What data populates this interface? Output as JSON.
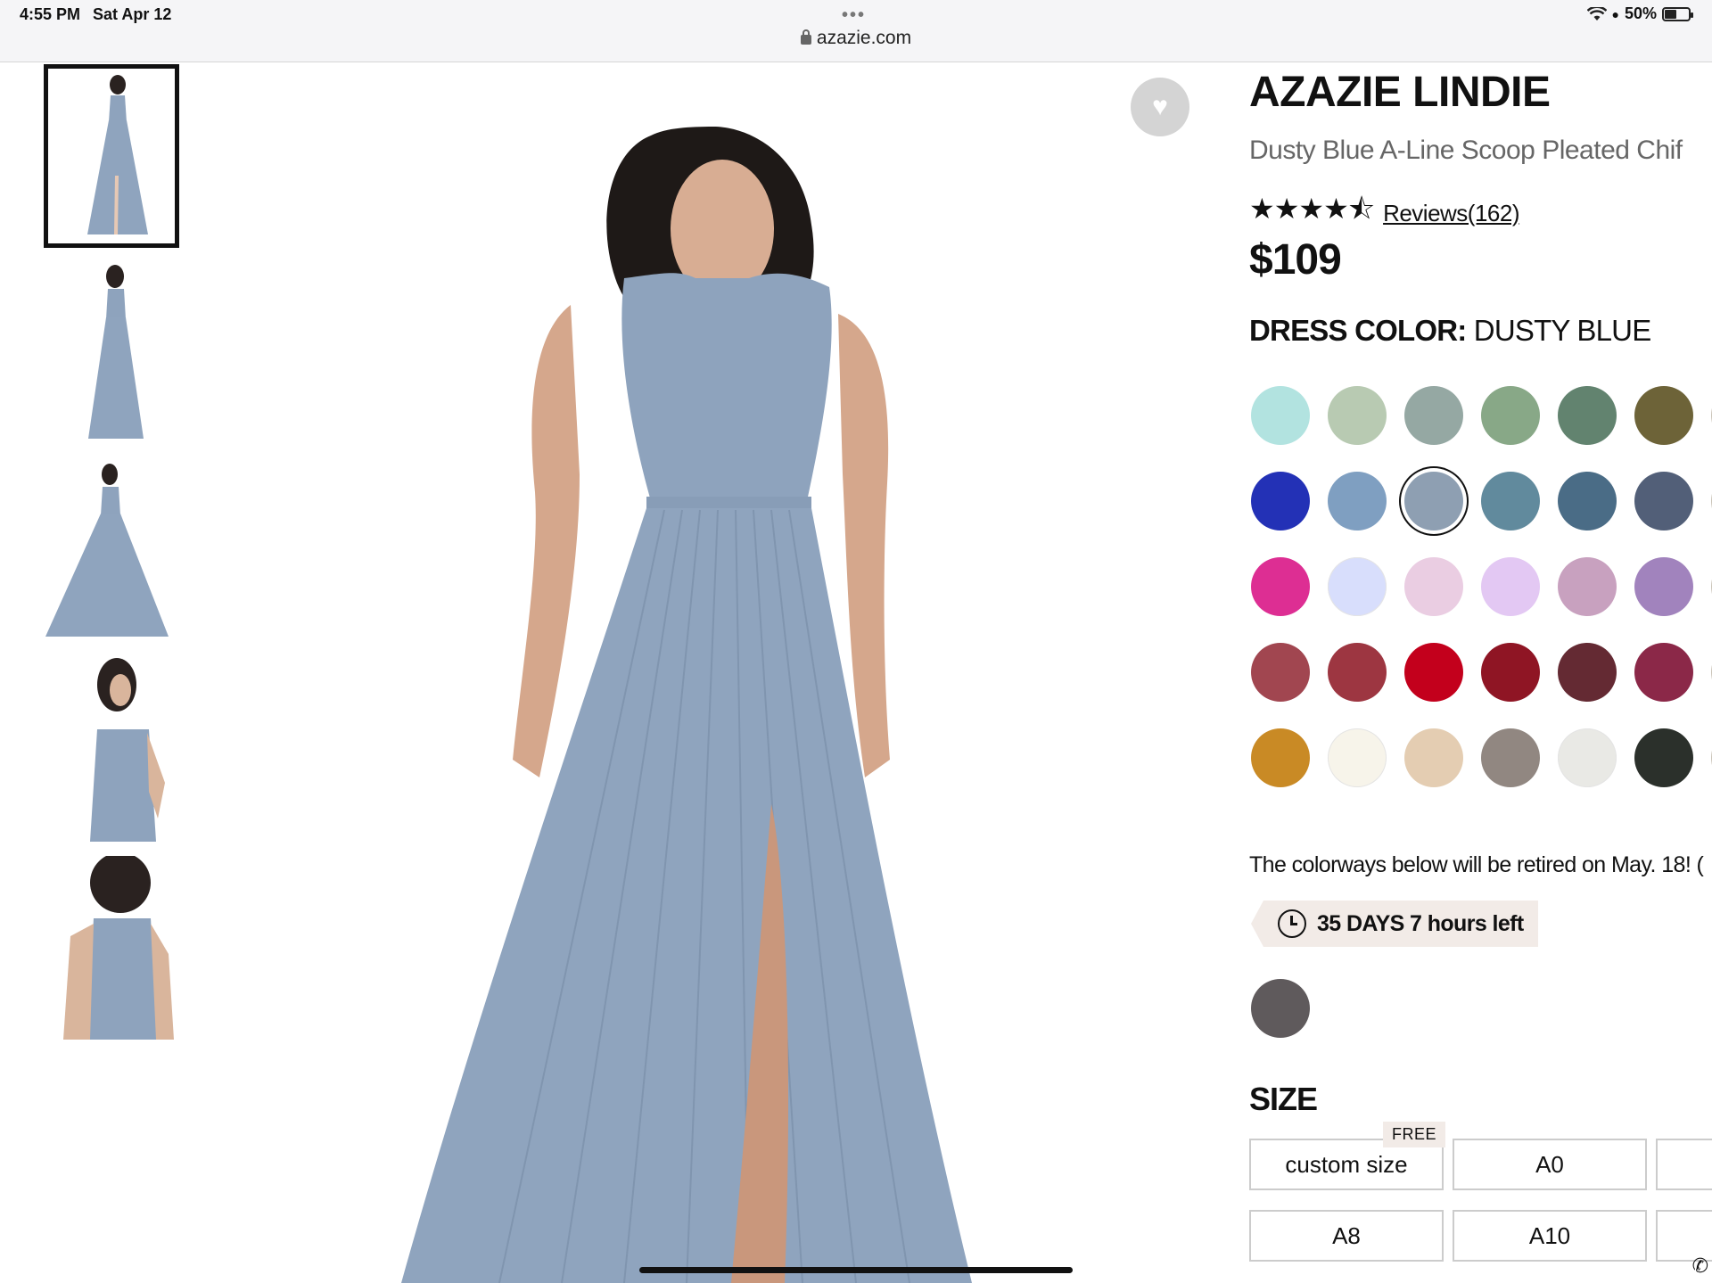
{
  "status_bar": {
    "time": "4:55 PM",
    "date": "Sat Apr 12",
    "battery": "50%",
    "url": "azazie.com"
  },
  "product": {
    "brand": "AZAZIE LINDIE",
    "subtitle": "Dusty Blue A-Line Scoop Pleated Chif",
    "rating_value": 4.5,
    "reviews": "Reviews(162)",
    "price": "$109",
    "dress_color_label": "DRESS COLOR:",
    "dress_color_value": "DUSTY BLUE"
  },
  "swatch_colors": [
    [
      "#b2e3e0",
      "#b8cab2",
      "#95a8a3",
      "#88a887",
      "#62836f",
      "#6d6338"
    ],
    [
      "#2331b6",
      "#7f9fc1",
      "#8e9fb2",
      "#618a9d",
      "#4a6c86",
      "#525f78"
    ],
    [
      "#dd2e93",
      "#d8defc",
      "#eacde2",
      "#e3c8f3",
      "#c8a1bf",
      "#a183bd"
    ],
    [
      "#a14650",
      "#9d3641",
      "#c3001c",
      "#8f1524",
      "#642a33",
      "#8b2848"
    ],
    [
      "#c98a25",
      "#f7f4ea",
      "#e4cdb2",
      "#918781",
      "#e9e9e5",
      "#2b302b"
    ]
  ],
  "selected_swatch": "dusty-blue",
  "retire": {
    "notice": "The colorways below will be retired on May. 18! (",
    "countdown": "35 DAYS 7 hours left",
    "retired_color": "#5f5a5c"
  },
  "size": {
    "title": "SIZE",
    "free_badge": "FREE",
    "options": [
      "custom size",
      "A0",
      "A8",
      "A10"
    ]
  },
  "colors": {
    "dress": "#8ea3bd",
    "accent": "#111111",
    "badge_bg": "#f2ebe7"
  },
  "icons": [
    "heart-icon",
    "lock-icon",
    "wifi-icon",
    "clock-icon",
    "star-icon",
    "phone-icon"
  ]
}
